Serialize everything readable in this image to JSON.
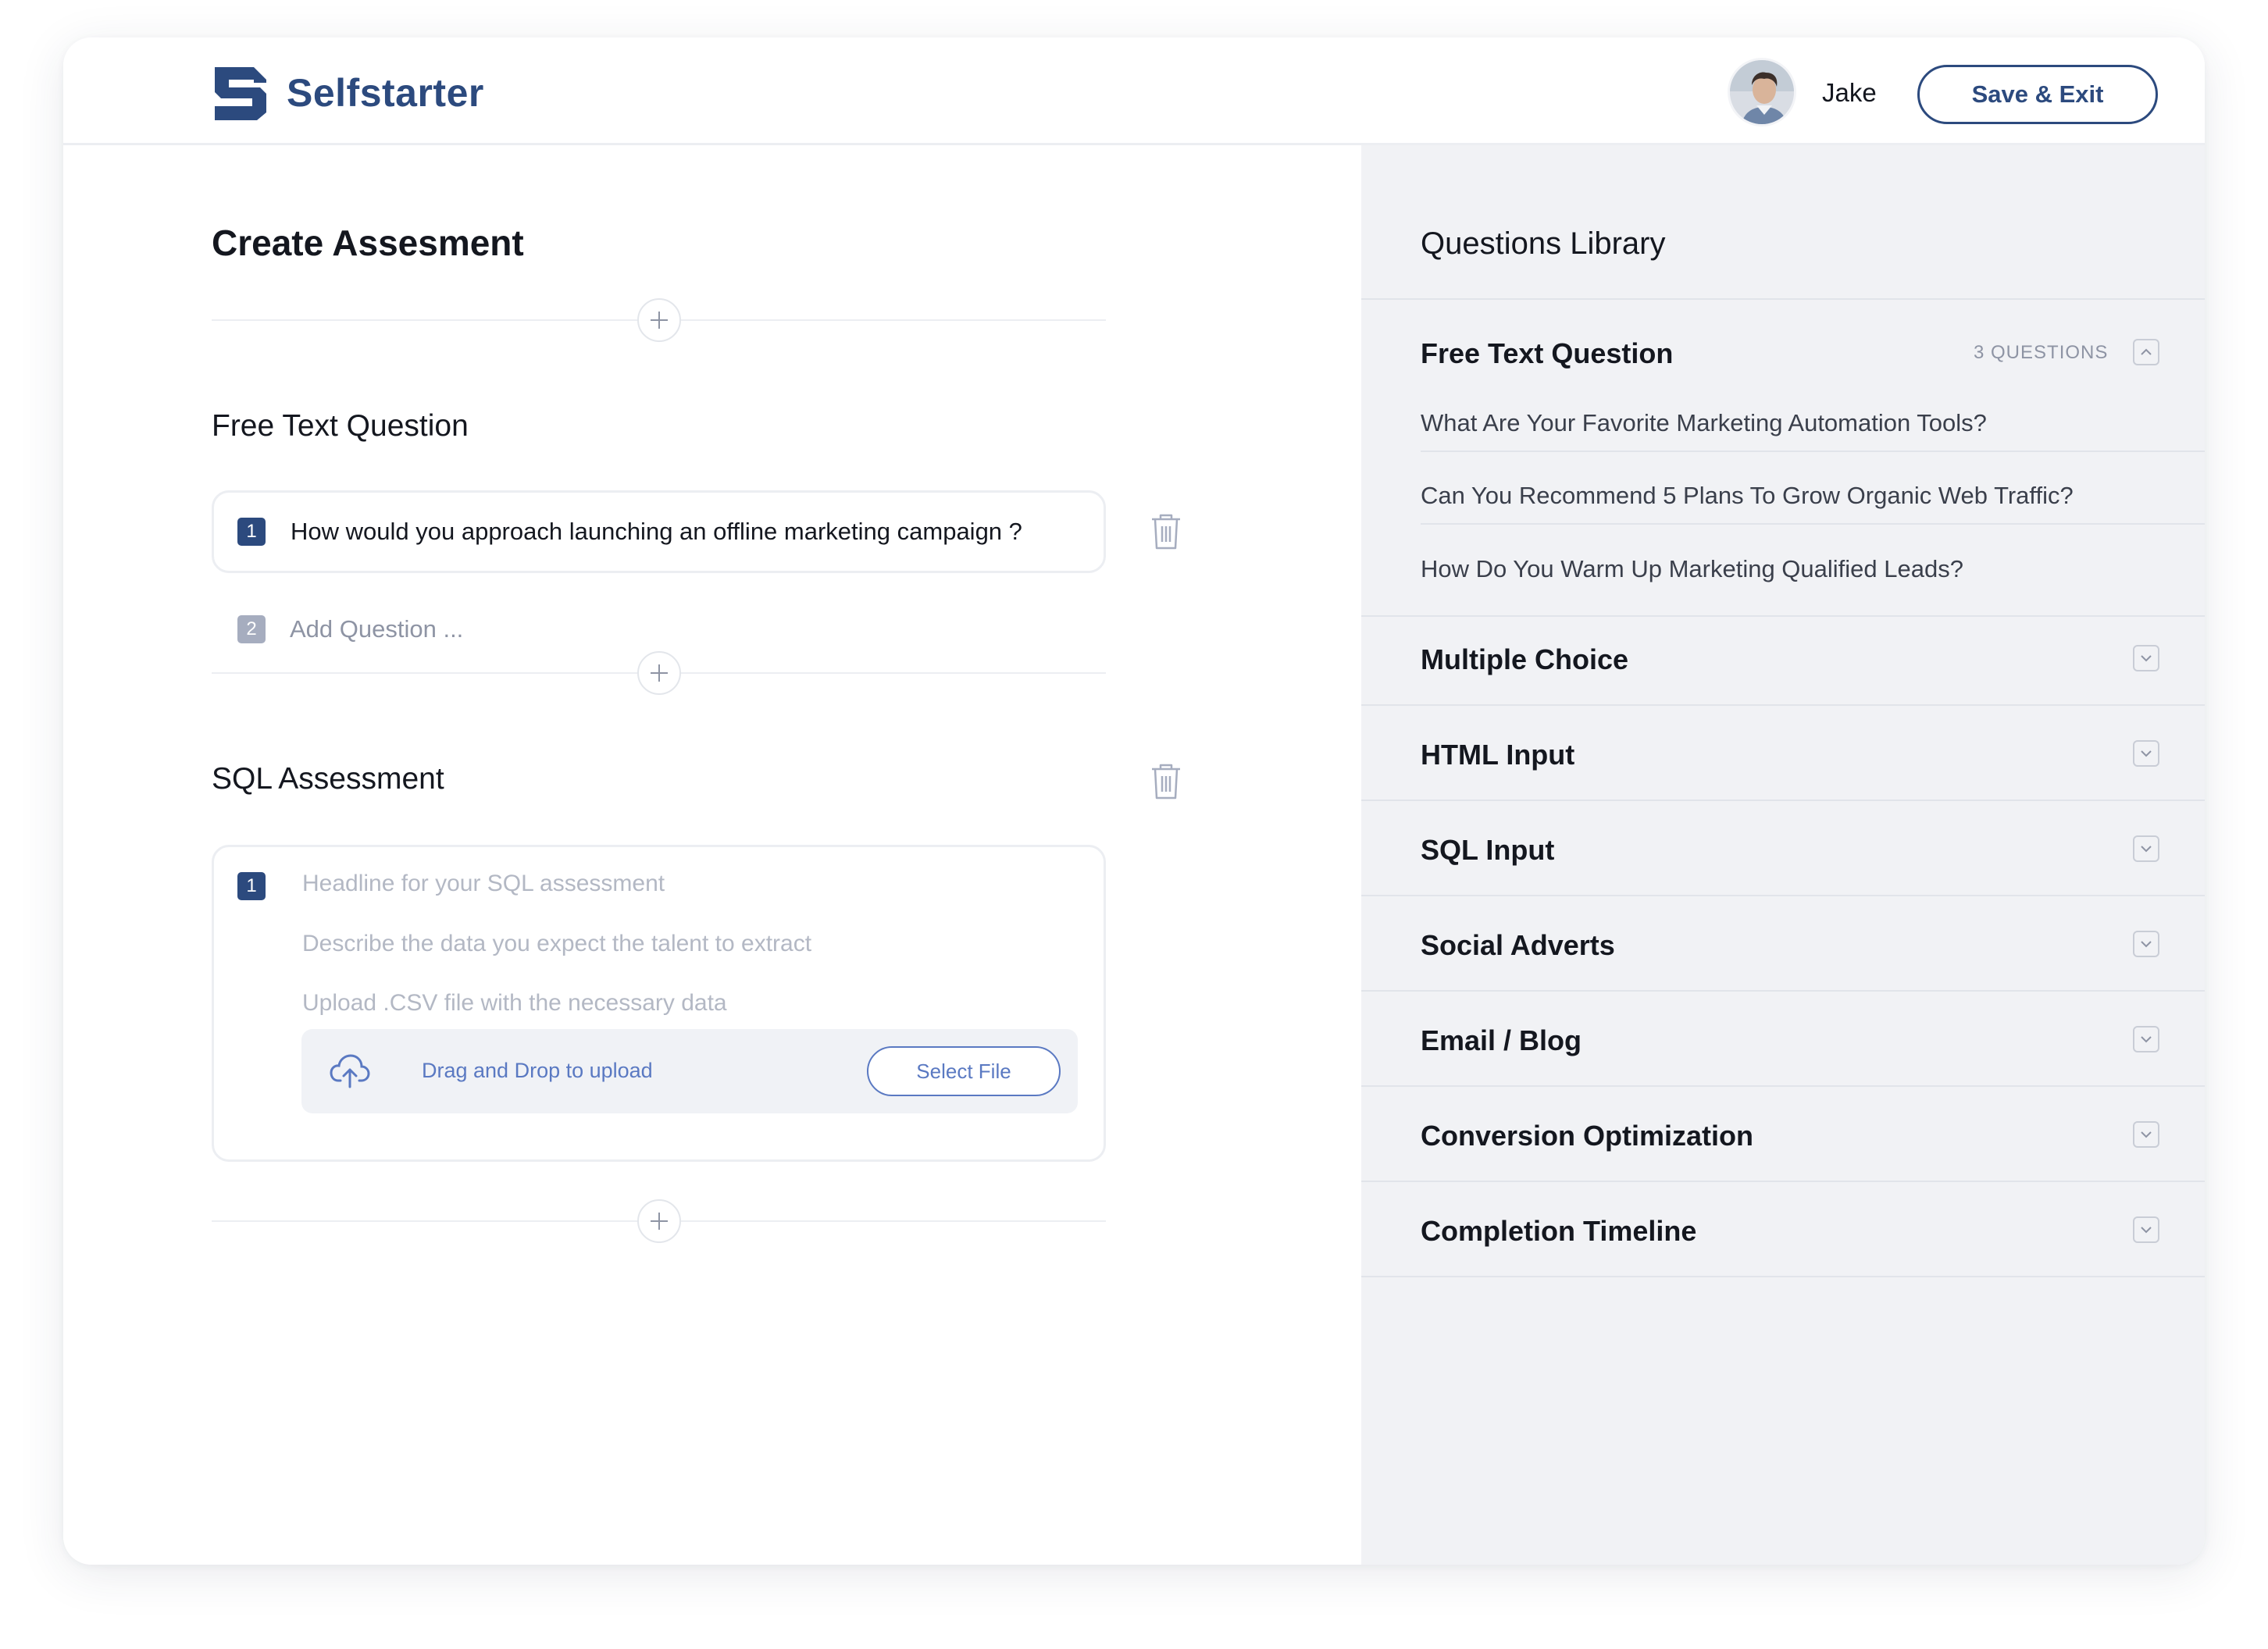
{
  "header": {
    "brand": "Selfstarter",
    "user_name": "Jake",
    "save_exit_label": "Save & Exit"
  },
  "editor": {
    "page_title": "Create Assesment",
    "free_text_section": {
      "title": "Free Text Question",
      "questions": [
        {
          "number": "1",
          "text": "How would you approach launching an offline marketing campaign ?"
        }
      ],
      "add_question": {
        "number": "2",
        "placeholder": "Add Question ..."
      }
    },
    "sql_section": {
      "title": "SQL Assessment",
      "number": "1",
      "headline_placeholder": "Headline for your SQL assessment",
      "description_placeholder": "Describe the data you expect the talent to extract",
      "upload_hint": "Upload .CSV file with the necessary data",
      "dropzone_text": "Drag and Drop to upload",
      "select_file_label": "Select File"
    }
  },
  "library": {
    "title": "Questions Library",
    "expanded": {
      "title": "Free Text Question",
      "count_label": "3 QUESTIONS",
      "questions": [
        "What Are Your Favorite Marketing Automation Tools?",
        "Can You Recommend 5 Plans To Grow Organic Web Traffic?",
        "How Do You Warm Up Marketing Qualified Leads?"
      ]
    },
    "categories": [
      "Multiple Choice",
      "HTML Input",
      "SQL Input",
      "Social Adverts",
      "Email / Blog",
      "Conversion Optimization",
      "Completion Timeline"
    ]
  },
  "colors": {
    "brand": "#2c4a7e",
    "accent": "#5a79c2",
    "library_bg": "#f1f2f5"
  },
  "icons": [
    "logo-mark-icon",
    "plus-icon",
    "trash-icon",
    "upload-cloud-icon",
    "chevron-up-icon",
    "chevron-down-icon"
  ]
}
